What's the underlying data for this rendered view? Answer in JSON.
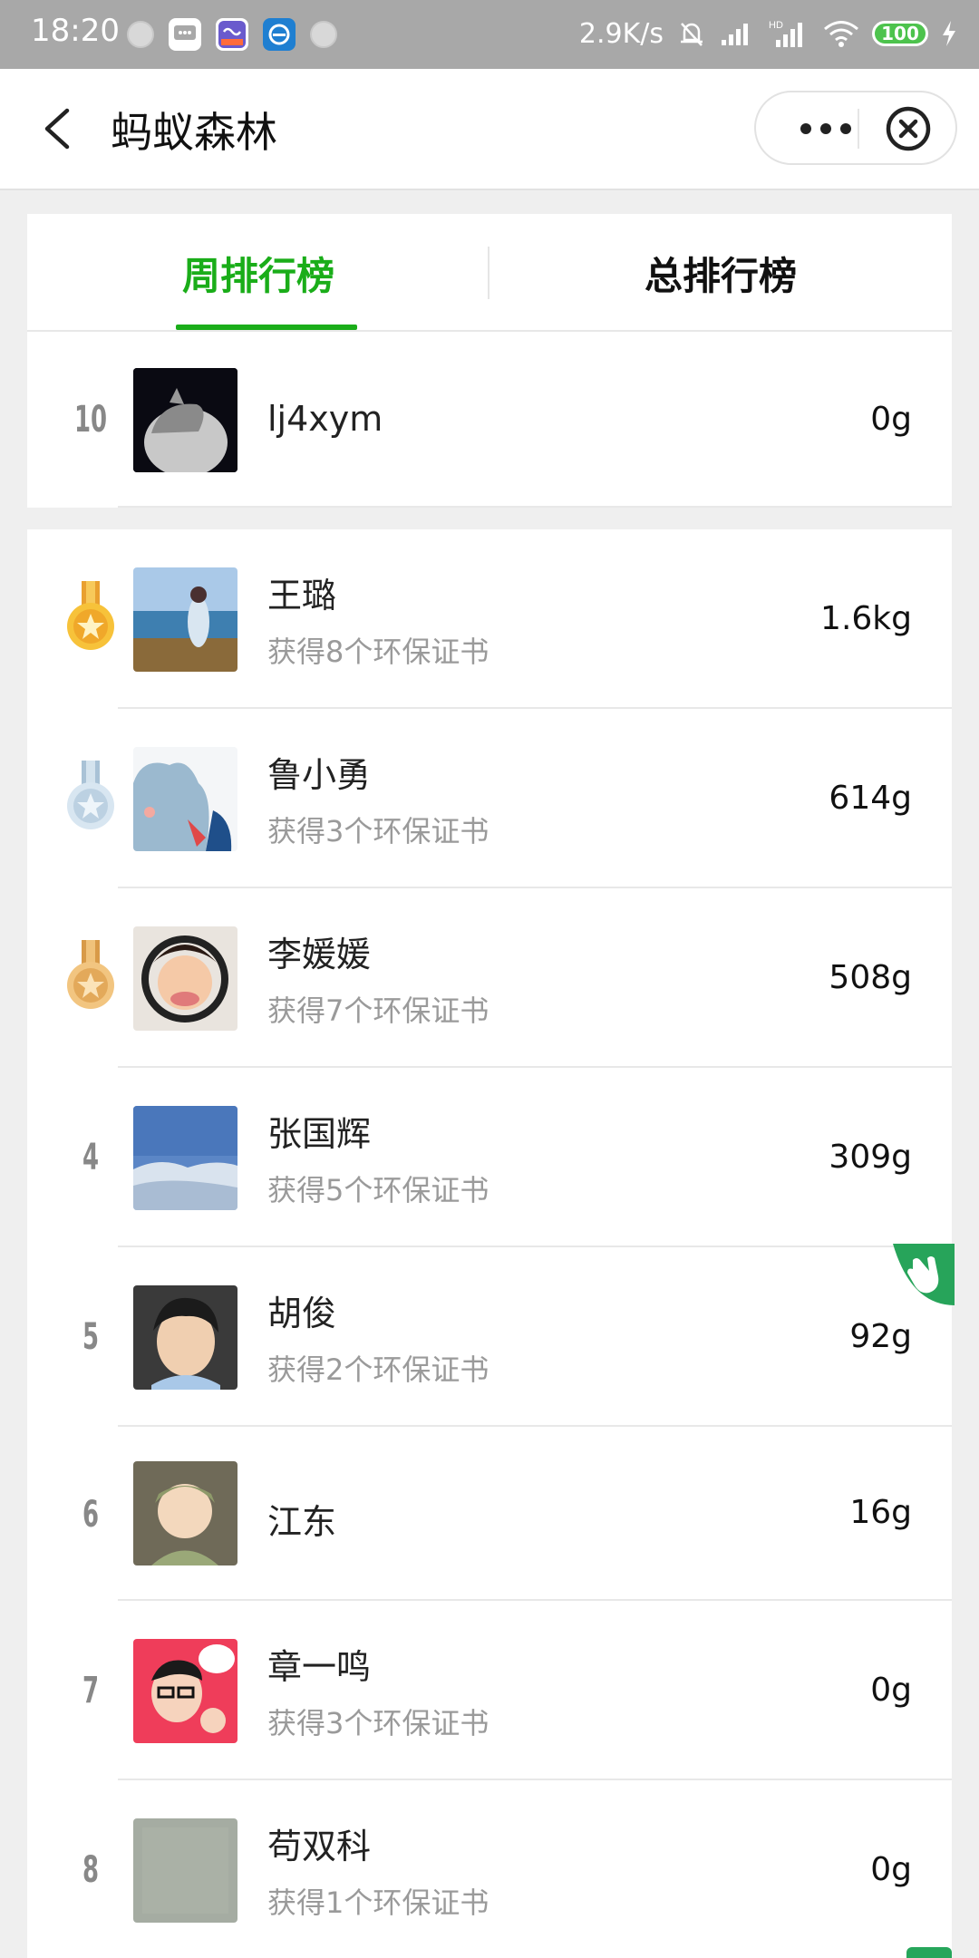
{
  "status_bar": {
    "time": "18:20",
    "net_speed": "2.9K/s",
    "battery": "100",
    "icons": [
      "circle-icon",
      "message-icon",
      "app-icon",
      "browser-icon",
      "circle-icon",
      "mute-bell-icon",
      "signal-icon",
      "hd-signal-icon",
      "wifi-icon",
      "charging-icon"
    ]
  },
  "navbar": {
    "title": "蚂蚁森林",
    "back_icon": "chevron-left-icon",
    "more_icon": "more-dots-icon",
    "close_icon": "close-circle-icon"
  },
  "tabs": [
    {
      "label": "周排行榜",
      "active": true
    },
    {
      "label": "总排行榜",
      "active": false
    }
  ],
  "colors": {
    "accent": "#1aad19",
    "gold": "#f0b63c",
    "silver": "#c5d7e6",
    "bronze": "#e3b26a"
  },
  "my_rank": {
    "rank": "10",
    "name": "lj4xym",
    "value": "0g"
  },
  "ranking": [
    {
      "rank": "1",
      "medal": "gold-medal-icon",
      "name": "王璐",
      "sub": "获得8个环保证书",
      "value": "1.6kg"
    },
    {
      "rank": "2",
      "medal": "silver-medal-icon",
      "name": "鲁小勇",
      "sub": "获得3个环保证书",
      "value": "614g"
    },
    {
      "rank": "3",
      "medal": "bronze-medal-icon",
      "name": "李媛媛",
      "sub": "获得7个环保证书",
      "value": "508g"
    },
    {
      "rank": "4",
      "name": "张国辉",
      "sub": "获得5个环保证书",
      "value": "309g"
    },
    {
      "rank": "5",
      "name": "胡俊",
      "sub": "获得2个环保证书",
      "value": "92g"
    },
    {
      "rank": "6",
      "name": "江东",
      "sub": "",
      "value": "16g"
    },
    {
      "rank": "7",
      "name": "章一鸣",
      "sub": "获得3个环保证书",
      "value": "0g"
    },
    {
      "rank": "8",
      "name": "苟双科",
      "sub": "获得1个环保证书",
      "value": "0g"
    }
  ]
}
